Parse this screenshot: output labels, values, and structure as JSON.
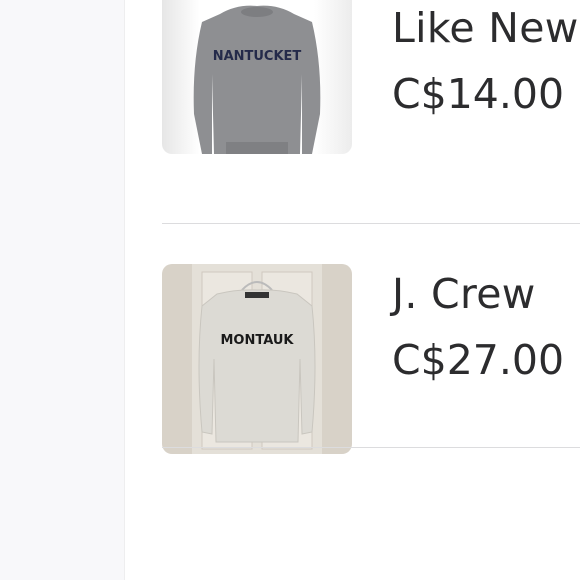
{
  "listings": [
    {
      "title": "Like New",
      "price": "C$14.00",
      "image_text": "NANTUCKET",
      "sweater_color": "#8e8f92"
    },
    {
      "title": "J. Crew",
      "price": "C$27.00",
      "image_text": "MONTAUK",
      "sweater_color": "#dcdad4"
    }
  ]
}
